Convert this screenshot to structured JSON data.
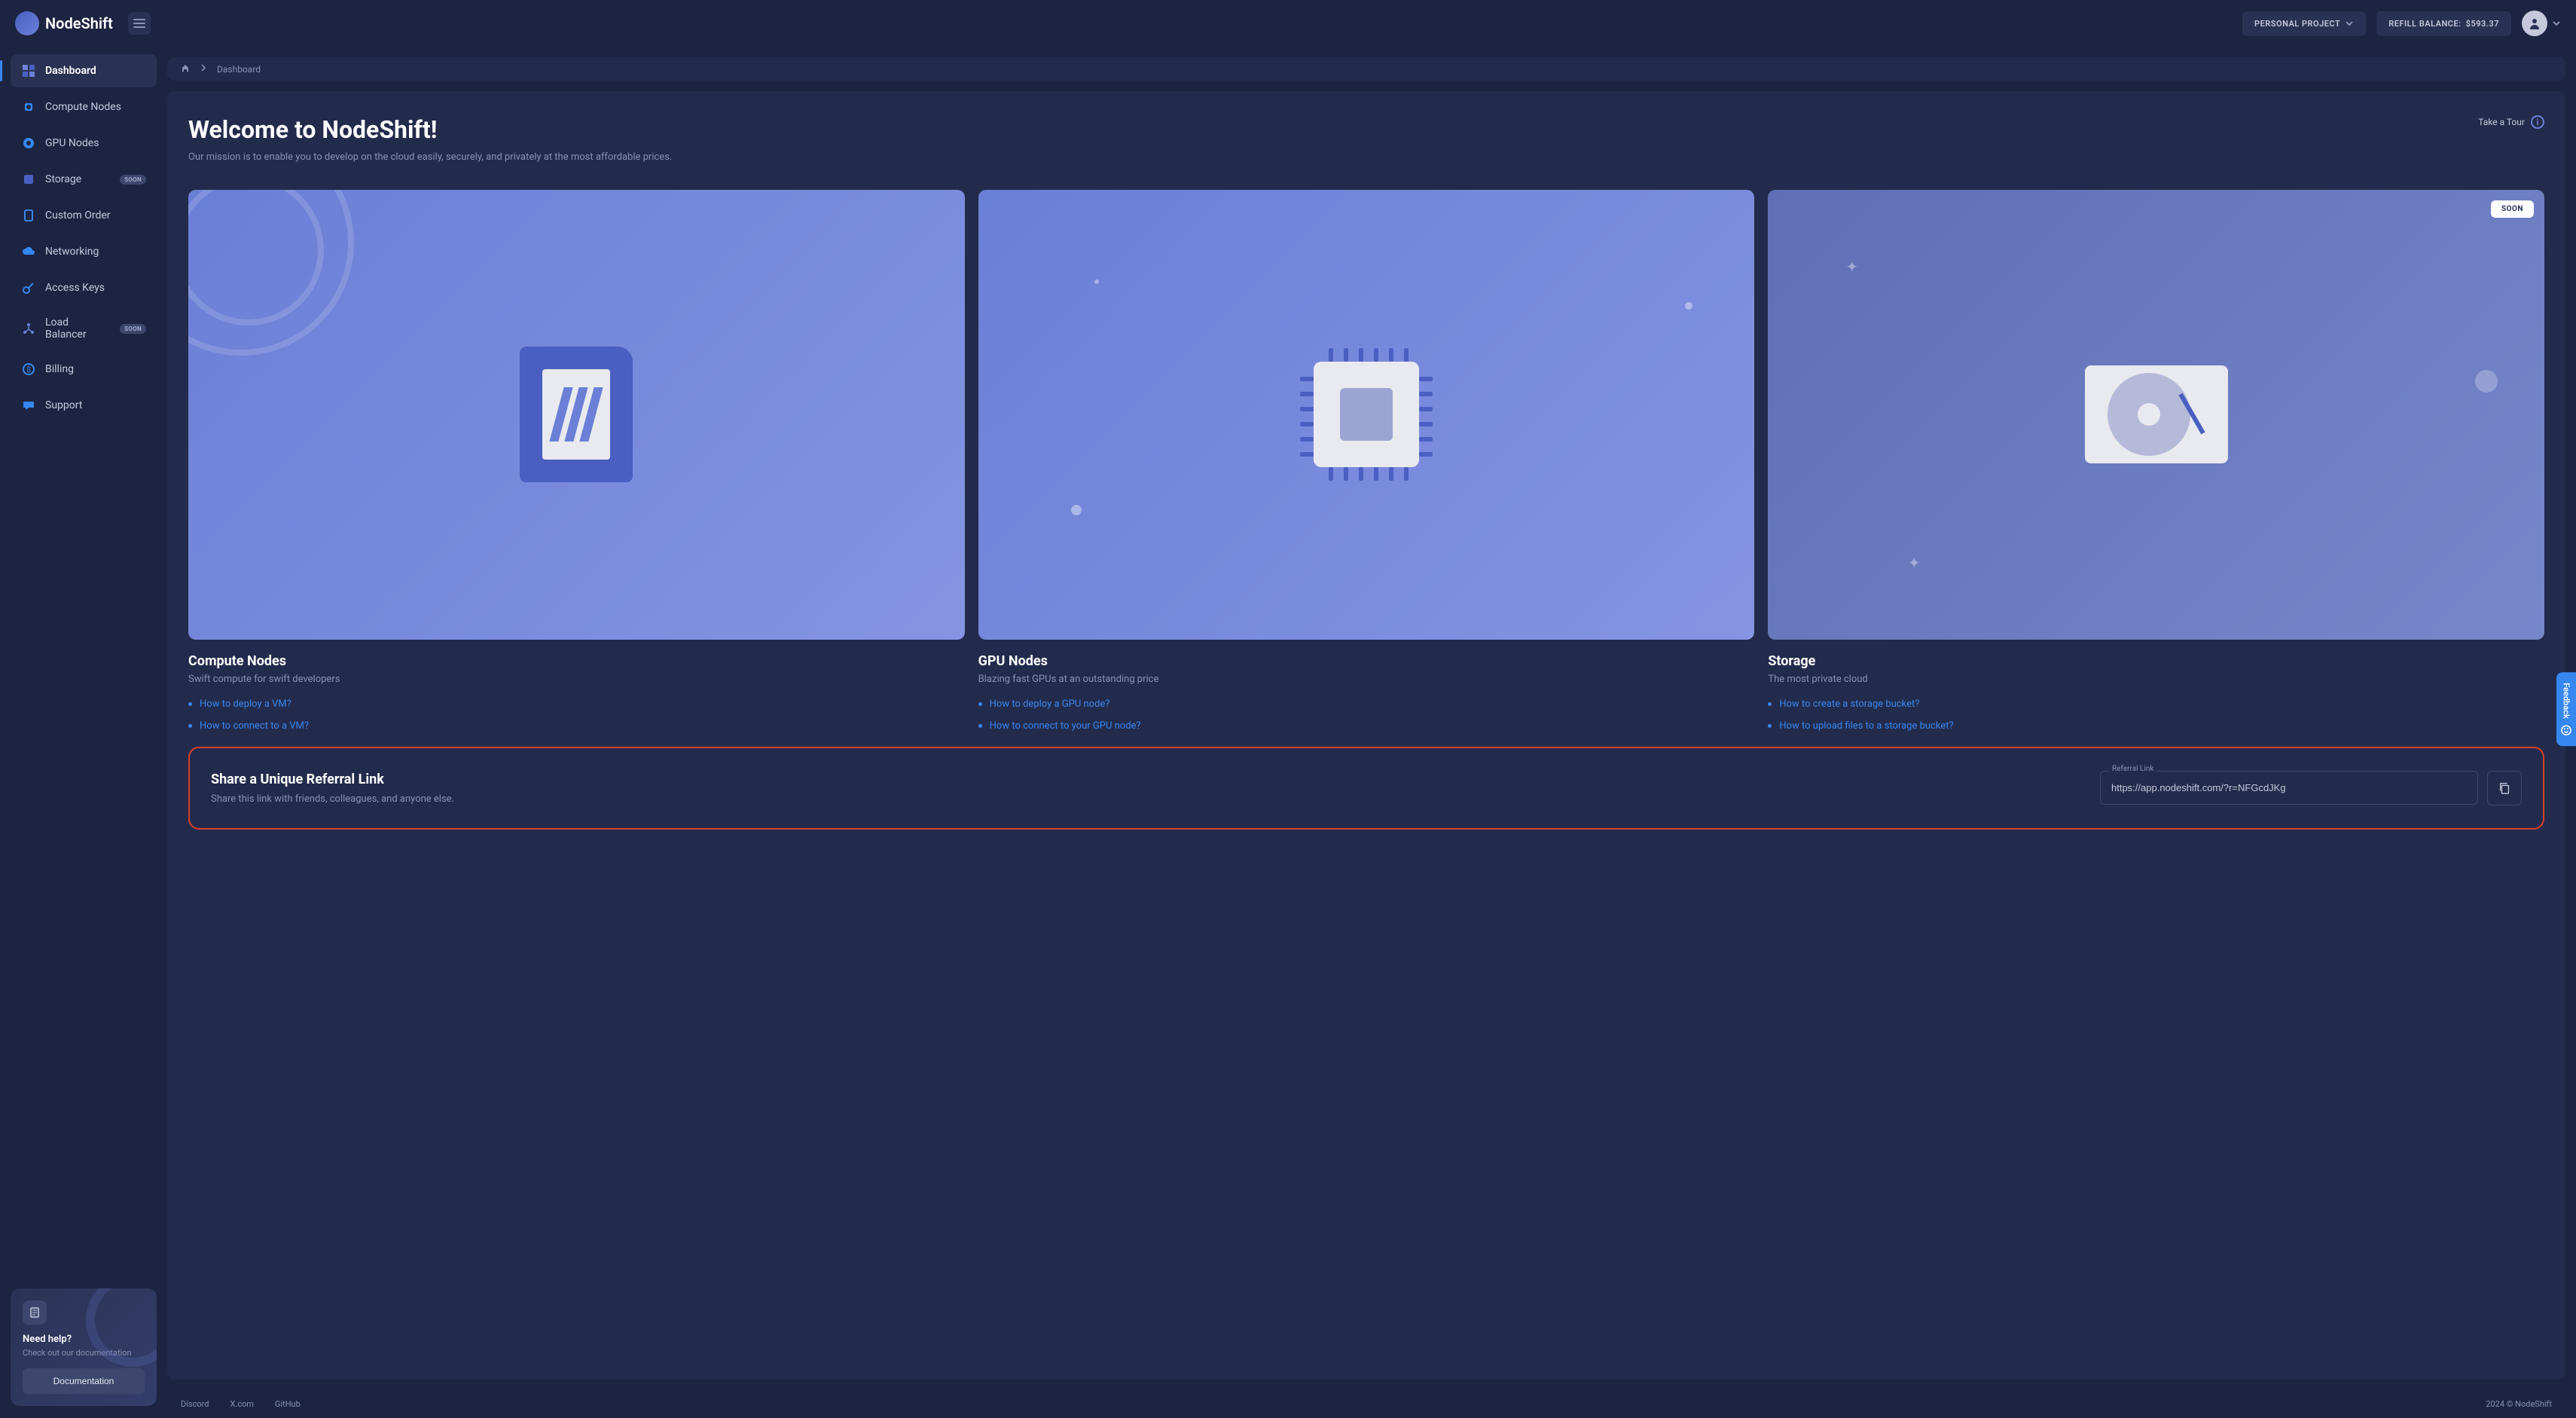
{
  "brand": {
    "name": "NodeShift"
  },
  "header": {
    "project_label": "PERSONAL PROJECT",
    "refill_label": "REFILL BALANCE:",
    "balance": "$593.37"
  },
  "sidebar": {
    "items": [
      {
        "label": "Dashboard",
        "active": true
      },
      {
        "label": "Compute Nodes"
      },
      {
        "label": "GPU Nodes"
      },
      {
        "label": "Storage",
        "soon": true
      },
      {
        "label": "Custom Order"
      },
      {
        "label": "Networking"
      },
      {
        "label": "Access Keys"
      },
      {
        "label": "Load Balancer",
        "soon": true
      },
      {
        "label": "Billing"
      },
      {
        "label": "Support"
      }
    ],
    "soon_badge": "SOON",
    "help": {
      "title": "Need help?",
      "subtitle": "Check out our documentation",
      "button": "Documentation"
    }
  },
  "breadcrumb": {
    "current": "Dashboard"
  },
  "welcome": {
    "title": "Welcome to NodeShift!",
    "subtitle": "Our mission is to enable you to develop on the cloud easily, securely, and privately at the most affordable prices.",
    "tour": "Take a Tour"
  },
  "cards": {
    "compute": {
      "title": "Compute Nodes",
      "subtitle": "Swift compute for swift developers",
      "links": [
        "How to deploy a VM?",
        "How to connect to a VM?"
      ]
    },
    "gpu": {
      "title": "GPU Nodes",
      "subtitle": "Blazing fast GPUs at an outstanding price",
      "links": [
        "How to deploy a GPU node?",
        "How to connect to your GPU node?"
      ]
    },
    "storage": {
      "title": "Storage",
      "subtitle": "The most private cloud",
      "soon_badge": "SOON",
      "links": [
        "How to create a storage bucket?",
        "How to upload files to a storage bucket?"
      ]
    }
  },
  "referral": {
    "title": "Share a Unique Referral Link",
    "subtitle": "Share this link with friends, colleagues, and anyone else.",
    "input_label": "Referral Link",
    "input_value": "https://app.nodeshift.com/?r=NFGcdJKg"
  },
  "footer": {
    "links": [
      "Discord",
      "X.com",
      "GitHub"
    ],
    "copyright": "2024 © NodeShift"
  },
  "feedback": {
    "label": "Feedback"
  }
}
